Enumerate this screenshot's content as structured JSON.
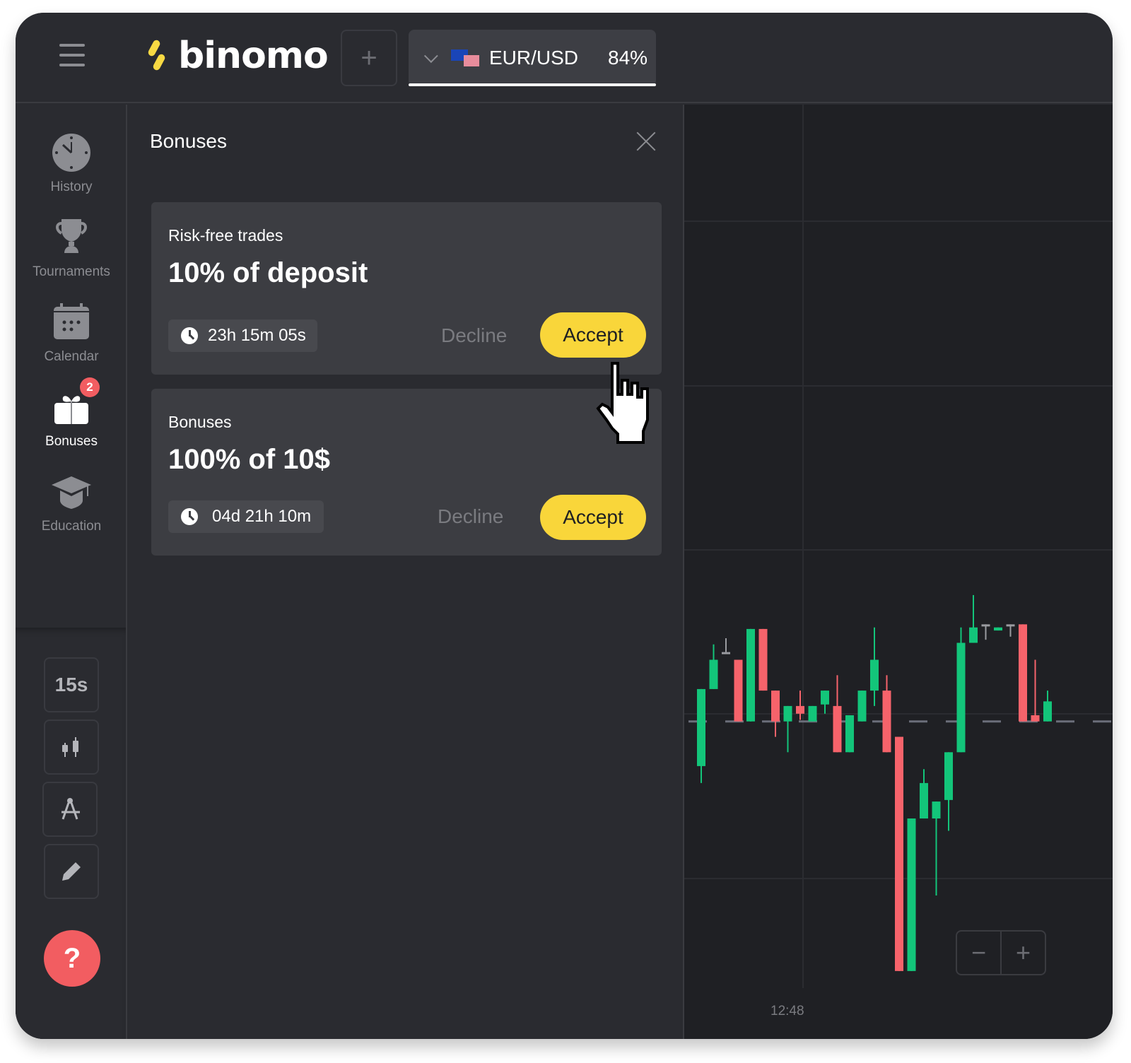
{
  "header": {
    "menu_icon": "hamburger-menu-icon",
    "brand": "binomo",
    "add_asset_label": "+",
    "asset": {
      "flag_icon": "eu-us-flag-icon",
      "name": "EUR/USD",
      "payout": "84%"
    }
  },
  "sidebar": {
    "items": [
      {
        "label": "History",
        "icon": "clock-icon",
        "active": false
      },
      {
        "label": "Tournaments",
        "icon": "trophy-icon",
        "active": false
      },
      {
        "label": "Calendar",
        "icon": "calendar-icon",
        "active": false
      },
      {
        "label": "Bonuses",
        "icon": "gift-icon",
        "active": true,
        "badge": "2"
      },
      {
        "label": "Education",
        "icon": "graduation-cap-icon",
        "active": false
      }
    ],
    "tools": {
      "timeframe": "15s",
      "chart_type_icon": "candlestick-icon",
      "indicators_icon": "compass-icon",
      "draw_icon": "pencil-icon"
    },
    "help_label": "?"
  },
  "panel": {
    "title": "Bonuses",
    "close_icon": "close-icon",
    "cards": [
      {
        "type": "Risk-free trades",
        "amount": "10% of deposit",
        "timer": "23h 15m 05s",
        "decline_label": "Decline",
        "accept_label": "Accept"
      },
      {
        "type": "Bonuses",
        "amount": "100% of 10$",
        "timer": "04d 21h 10m",
        "decline_label": "Decline",
        "accept_label": "Accept"
      }
    ]
  },
  "chart": {
    "time_label": "12:48",
    "zoom_out_label": "−",
    "zoom_in_label": "+",
    "colors": {
      "up": "#13c57a",
      "down": "#f6636b",
      "doji": "#9a9ba0",
      "grid": "#2b2c31",
      "ref_line": "#6b6e7a"
    }
  },
  "chart_data": {
    "type": "candlestick",
    "title": "",
    "xlabel": "",
    "ylabel": "",
    "x_tick_labels": [
      "12:48"
    ],
    "ylim": [
      0,
      100
    ],
    "note": "relative price units (no y-axis labels visible); higher value = higher price",
    "candles": [
      {
        "o": 45.6,
        "c": 50.6,
        "h": 50.6,
        "l": 44.5
      },
      {
        "o": 50.6,
        "c": 52.5,
        "h": 53.5,
        "l": 50.6
      },
      {
        "o": 53.0,
        "c": 53.0,
        "h": 53.9,
        "l": 53.0
      },
      {
        "o": 52.5,
        "c": 48.5,
        "h": 52.5,
        "l": 48.5
      },
      {
        "o": 48.5,
        "c": 54.5,
        "h": 54.5,
        "l": 48.5
      },
      {
        "o": 54.5,
        "c": 50.5,
        "h": 54.5,
        "l": 50.5
      },
      {
        "o": 50.5,
        "c": 48.5,
        "h": 50.5,
        "l": 47.5
      },
      {
        "o": 48.5,
        "c": 49.5,
        "h": 49.5,
        "l": 46.5
      },
      {
        "o": 49.5,
        "c": 49.0,
        "h": 50.5,
        "l": 48.6
      },
      {
        "o": 48.5,
        "c": 49.5,
        "h": 49.5,
        "l": 48.5
      },
      {
        "o": 49.6,
        "c": 50.5,
        "h": 50.5,
        "l": 49.0
      },
      {
        "o": 49.5,
        "c": 46.5,
        "h": 51.5,
        "l": 46.5
      },
      {
        "o": 46.5,
        "c": 48.9,
        "h": 48.9,
        "l": 46.5
      },
      {
        "o": 48.5,
        "c": 50.5,
        "h": 50.5,
        "l": 48.5
      },
      {
        "o": 50.5,
        "c": 52.5,
        "h": 54.6,
        "l": 49.5
      },
      {
        "o": 50.5,
        "c": 46.5,
        "h": 51.5,
        "l": 46.5
      },
      {
        "o": 47.5,
        "c": 32.3,
        "h": 47.5,
        "l": 32.3
      },
      {
        "o": 32.3,
        "c": 42.2,
        "h": 42.2,
        "l": 32.3
      },
      {
        "o": 42.2,
        "c": 44.5,
        "h": 45.4,
        "l": 42.2
      },
      {
        "o": 42.2,
        "c": 43.3,
        "h": 43.3,
        "l": 37.2
      },
      {
        "o": 43.4,
        "c": 46.5,
        "h": 46.5,
        "l": 41.4
      },
      {
        "o": 46.5,
        "c": 53.6,
        "h": 54.6,
        "l": 46.5
      },
      {
        "o": 53.6,
        "c": 54.6,
        "h": 56.7,
        "l": 53.6
      },
      {
        "o": 54.8,
        "c": 54.8,
        "h": 54.8,
        "l": 53.8
      },
      {
        "o": 54.4,
        "c": 54.6,
        "h": 54.6,
        "l": 54.4
      },
      {
        "o": 54.8,
        "c": 54.8,
        "h": 54.8,
        "l": 54.0
      },
      {
        "o": 54.8,
        "c": 48.5,
        "h": 54.8,
        "l": 48.5
      },
      {
        "o": 48.9,
        "c": 48.5,
        "h": 52.5,
        "l": 48.5
      },
      {
        "o": 48.5,
        "c": 49.8,
        "h": 50.5,
        "l": 48.5
      }
    ],
    "reference_line": 48.5
  }
}
